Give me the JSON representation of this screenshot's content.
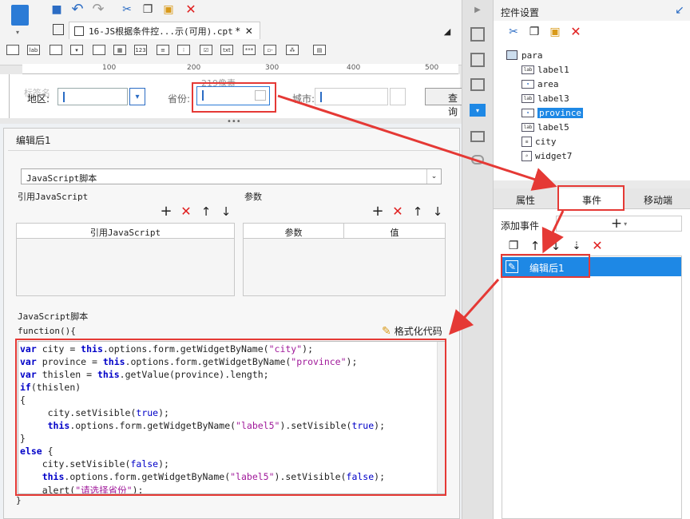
{
  "designer": {
    "file_tab": "16-JS根据条件控...示(可用).cpt",
    "tab_modified_mark": "*",
    "ruler": [
      "100",
      "200",
      "300",
      "400",
      "500"
    ],
    "form": {
      "top_label": "标签名",
      "size_label": "219像素",
      "region_label": "地区:",
      "province_label": "省份:",
      "city_label": "城市:",
      "query_button": "查询"
    }
  },
  "editor": {
    "title": "编辑后1",
    "script_type": "JavaScript脚本",
    "ref_js_title": "引用JavaScript",
    "ref_js_col": "引用JavaScript",
    "params_title": "参数",
    "params_col_name": "参数",
    "params_col_value": "值",
    "script_section": "JavaScript脚本",
    "function_open": "function(){",
    "format_code": "格式化代码",
    "function_close": "}",
    "code_text": [
      "var city = this.options.form.getWidgetByName(\"city\");",
      "var province = this.options.form.getWidgetByName(\"province\");",
      "var thislen = this.getValue(province).length;",
      "if(thislen)",
      "{",
      "     city.setVisible(true);",
      "     this.options.form.getWidgetByName(\"label5\").setVisible(true);",
      "}",
      "else {",
      "    city.setVisible(false);",
      "    this.options.form.getWidgetByName(\"label5\").setVisible(false);",
      "    alert(\"请选择省份\");"
    ]
  },
  "right_panel": {
    "title": "控件设置",
    "tree": [
      {
        "label": "para",
        "icon": "form-icon"
      },
      {
        "label": "label1",
        "icon": "label-icon"
      },
      {
        "label": "area",
        "icon": "combo-icon"
      },
      {
        "label": "label3",
        "icon": "label-icon"
      },
      {
        "label": "province",
        "icon": "combo-icon",
        "selected": true
      },
      {
        "label": "label5",
        "icon": "label-icon"
      },
      {
        "label": "city",
        "icon": "tree-combo-icon"
      },
      {
        "label": "widget7",
        "icon": "search-button-icon"
      }
    ],
    "tabs": [
      "属性",
      "事件",
      "移动端"
    ],
    "active_tab": "事件",
    "add_event_label": "添加事件",
    "event_item": "编辑后1"
  },
  "colors": {
    "accent": "#1e88e5",
    "highlight_red": "#e53935",
    "keyword": "#0000c8",
    "string": "#a0199a"
  }
}
